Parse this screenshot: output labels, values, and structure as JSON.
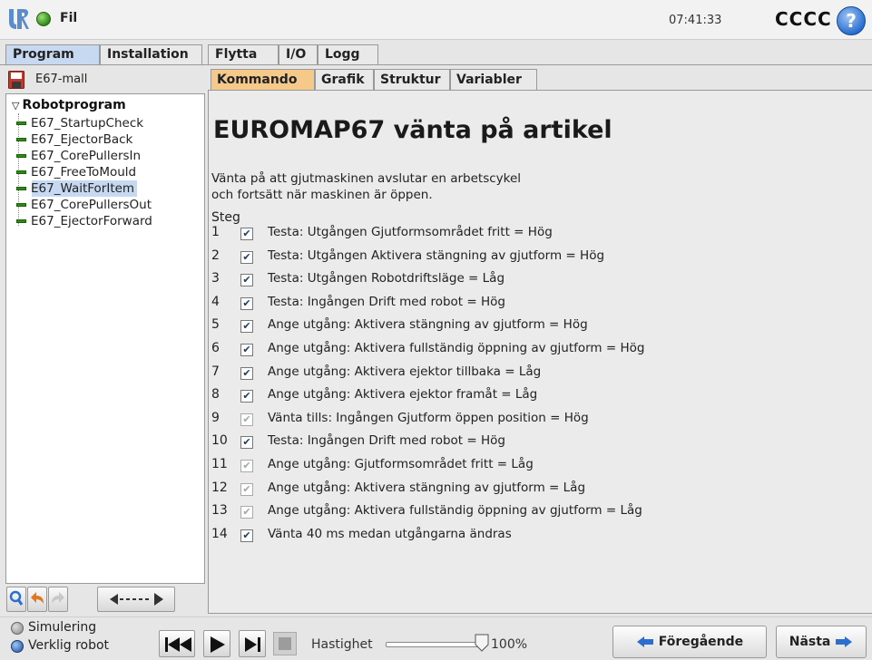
{
  "header": {
    "file_menu": "Fil",
    "time": "07:41:33",
    "robot_name": "CCCC",
    "help": "?"
  },
  "main_tabs": [
    {
      "label": "Program",
      "active": true
    },
    {
      "label": "Installation",
      "active": false
    },
    {
      "label": "Flytta",
      "active": false
    },
    {
      "label": "I/O",
      "active": false
    },
    {
      "label": "Logg",
      "active": false
    }
  ],
  "program": {
    "name": "E67-mall",
    "root": "Robotprogram",
    "items": [
      {
        "label": "E67_StartupCheck",
        "selected": false
      },
      {
        "label": "E67_EjectorBack",
        "selected": false
      },
      {
        "label": "E67_CorePullersIn",
        "selected": false
      },
      {
        "label": "E67_FreeToMould",
        "selected": false
      },
      {
        "label": "E67_WaitForItem",
        "selected": true
      },
      {
        "label": "E67_CorePullersOut",
        "selected": false
      },
      {
        "label": "E67_EjectorForward",
        "selected": false
      }
    ]
  },
  "sub_tabs": [
    {
      "label": "Kommando",
      "active": true
    },
    {
      "label": "Grafik",
      "active": false
    },
    {
      "label": "Struktur",
      "active": false
    },
    {
      "label": "Variabler",
      "active": false
    }
  ],
  "command": {
    "title": "EUROMAP67 vänta på artikel",
    "description_line1": "Vänta på att gjutmaskinen avslutar en arbetscykel",
    "description_line2": "och fortsätt när maskinen är öppen.",
    "steps_label": "Steg",
    "steps": [
      {
        "num": "1",
        "enabled": true,
        "text": "Testa: Utgången Gjutformsområdet fritt = Hög"
      },
      {
        "num": "2",
        "enabled": true,
        "text": "Testa: Utgången Aktivera stängning av gjutform = Hög"
      },
      {
        "num": "3",
        "enabled": true,
        "text": "Testa: Utgången Robotdriftsläge = Låg"
      },
      {
        "num": "4",
        "enabled": true,
        "text": "Testa: Ingången Drift med robot = Hög"
      },
      {
        "num": "5",
        "enabled": true,
        "text": "Ange utgång: Aktivera stängning av gjutform = Hög"
      },
      {
        "num": "6",
        "enabled": true,
        "text": "Ange utgång: Aktivera fullständig öppning av gjutform = Hög"
      },
      {
        "num": "7",
        "enabled": true,
        "text": "Ange utgång: Aktivera ejektor tillbaka = Låg"
      },
      {
        "num": "8",
        "enabled": true,
        "text": "Ange utgång: Aktivera ejektor framåt = Låg"
      },
      {
        "num": "9",
        "enabled": false,
        "text": "Vänta tills: Ingången Gjutform öppen position = Hög"
      },
      {
        "num": "10",
        "enabled": true,
        "text": "Testa: Ingången Drift med robot = Hög"
      },
      {
        "num": "11",
        "enabled": false,
        "text": "Ange utgång: Gjutformsområdet fritt = Låg"
      },
      {
        "num": "12",
        "enabled": false,
        "text": "Ange utgång: Aktivera stängning av gjutform = Låg"
      },
      {
        "num": "13",
        "enabled": false,
        "text": "Ange utgång: Aktivera fullständig öppning av gjutform = Låg"
      },
      {
        "num": "14",
        "enabled": true,
        "text": "Vänta 40 ms medan utgångarna ändras"
      }
    ]
  },
  "footer": {
    "mode_simulation": "Simulering",
    "mode_real": "Verklig robot",
    "speed_label": "Hastighet",
    "speed_value": "100%",
    "speed_fraction": 1.0,
    "prev_label": "Föregående",
    "next_label": "Nästa"
  },
  "colors": {
    "active_tab": "#c6d9f0",
    "active_subtab": "#f5c98a",
    "status_green": "#2f8a17",
    "nav_arrow": "#2a6fd0",
    "undo_arrow": "#e07820"
  }
}
